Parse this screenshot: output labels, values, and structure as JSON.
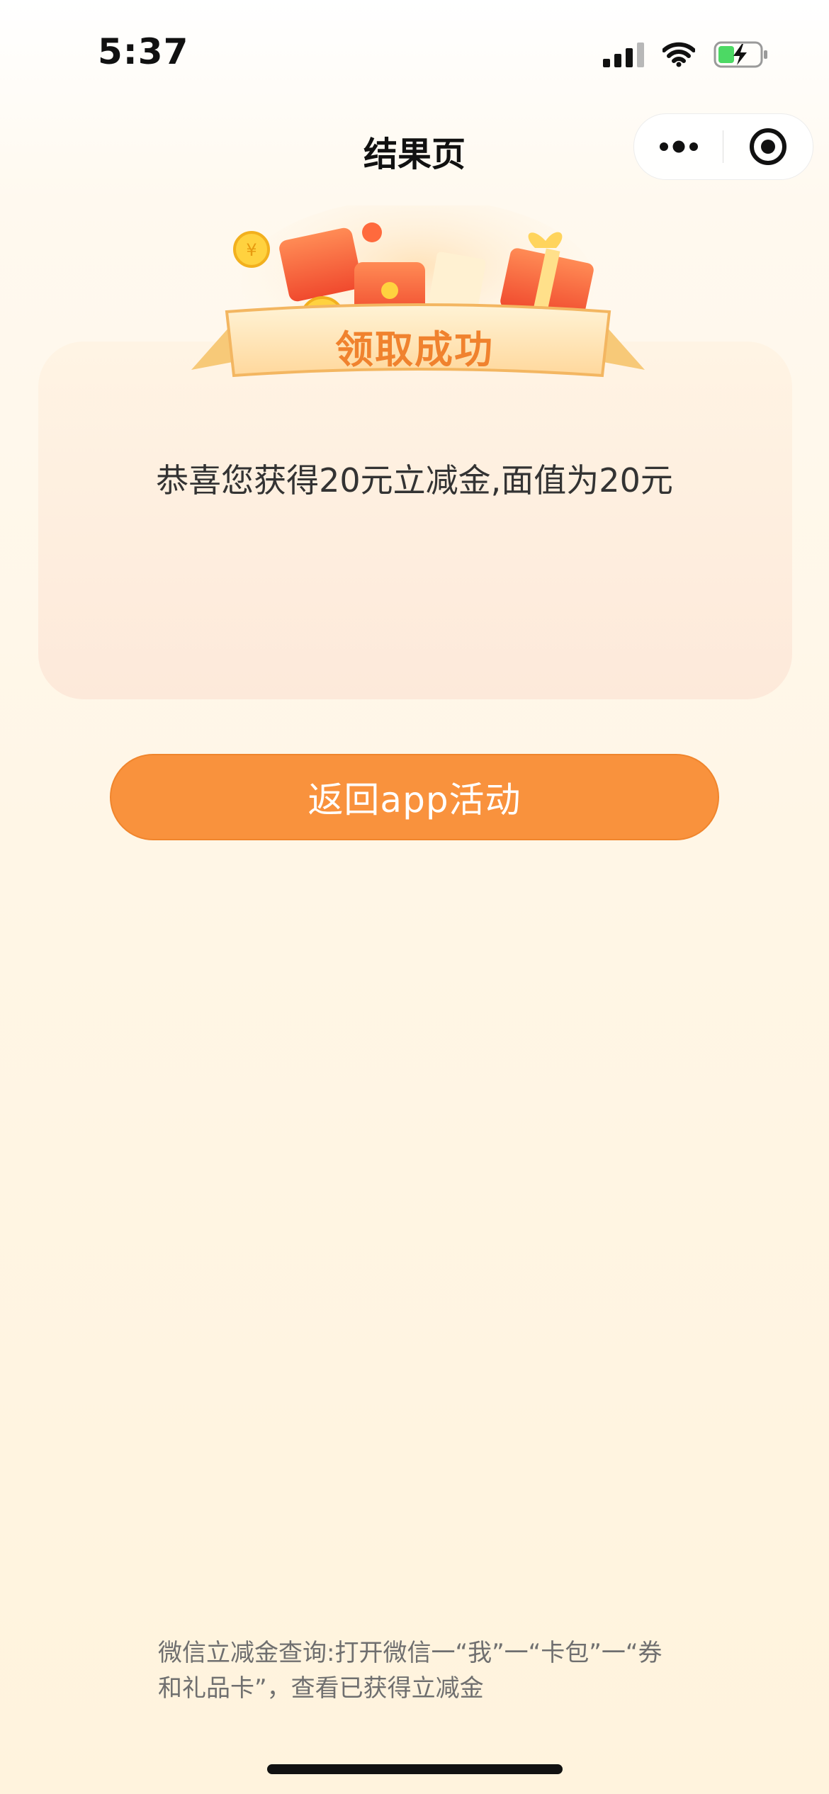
{
  "status_bar": {
    "time": "5:37",
    "icons": [
      "signal-icon",
      "wifi-icon",
      "battery-charging-icon"
    ]
  },
  "nav": {
    "title": "结果页",
    "capsule": {
      "more_icon": "more-dots-icon",
      "close_icon": "target-close-icon"
    }
  },
  "banner": {
    "label": "领取成功"
  },
  "card": {
    "message": "恭喜您获得20元立减金,面值为20元"
  },
  "actions": {
    "return_label": "返回app活动"
  },
  "footer": {
    "hint_line1": "微信立减金查询:打开微信一“我”一“卡包”一“券",
    "hint_line2": "和礼品卡”，查看已获得立减金"
  },
  "colors": {
    "accent": "#f9923d",
    "banner_text": "#f0822e",
    "card_top": "#fff4e4",
    "card_bottom": "#fde9da",
    "battery_green": "#4cd964"
  }
}
